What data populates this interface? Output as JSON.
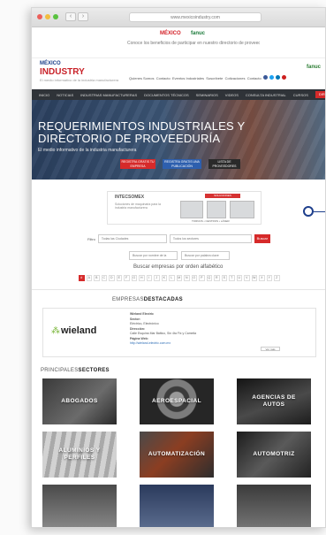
{
  "browser": {
    "url": "www.mexicoindustry.com",
    "back": "‹",
    "forward": "›"
  },
  "promo": {
    "brand_a": "MÉXICO",
    "brand_b": "fanuc",
    "text": "Conoce los beneficios de participar en nuestro directorio de proveedores"
  },
  "header": {
    "logo_top": "MÉXICO",
    "logo_main": "INDUSTRY",
    "tagline": "El medio informativo de la industria manufacturera",
    "links": [
      "Quienes Somos",
      "Contacto",
      "Eventos Industriales",
      "Suscríbete",
      "Cotizaciones",
      "Contacto"
    ],
    "sponsor": "fanuc"
  },
  "nav": {
    "items": [
      "INICIO",
      "NOTICIAS",
      "INDUSTRIAS MANUFACTURERAS",
      "DOCUMENTOS TÉCNICOS",
      "SEMINARIOS",
      "VIDEOS",
      "CONSULTA INDUSTRIAL",
      "CURSOS"
    ],
    "cta": "DIRECTORIO"
  },
  "hero": {
    "title": "REQUERIMIENTOS INDUSTRIALES Y DIRECTORIO DE PROVEEDURÍA",
    "subtitle": "El medio informativo de la industria manufacturera",
    "buttons": [
      "REGISTRA GRATIS TU EMPRESA",
      "REGISTRA GRATIS UNA PUBLICACIÓN",
      "LISTA DE PROVEEDORES"
    ]
  },
  "ad": {
    "title": "INTECSOMEX",
    "subtitle": "Soluciones de maquinaria para la industria manufacturera",
    "badge": "SOLUCIONES INDUSTRIALES",
    "labels": "TORNOS  •  CENTROS  •  LÁSER"
  },
  "search": {
    "label": "Filtro",
    "field1": "Todas las Ciudades",
    "field2": "Todos los sectores",
    "button": "Buscar",
    "field3": "Buscar por nombre de la",
    "field4": "Buscar por palabra clave"
  },
  "alphabet": {
    "label": "Buscar empresas por orden alfabético",
    "letters": [
      "#",
      "A",
      "B",
      "C",
      "D",
      "E",
      "F",
      "G",
      "H",
      "I",
      "J",
      "K",
      "L",
      "M",
      "N",
      "O",
      "P",
      "Q",
      "R",
      "S",
      "T",
      "U",
      "V",
      "W",
      "X",
      "Y",
      "Z"
    ]
  },
  "featured": {
    "title_light": "EMPRESAS",
    "title_bold": "DESTACADAS",
    "company": "wieland",
    "info_name": "Wieland Electric",
    "info_sector": "Sector:",
    "info_sector_val": "Eléctrico, Electrónico",
    "info_address": "Dirección:",
    "info_address_val": "Calle Esquina Mar Báltico, Sin 4ta Fix y Camelia",
    "info_web": "Página Web:",
    "info_web_val": "http://wieland-electric.com.mx",
    "more_button": "Ver más"
  },
  "sectors": {
    "title_light": "PRINCIPALES",
    "title_bold": "SECTORES",
    "tiles": [
      "ABOGADOS",
      "AEROESPACIAL",
      "AGENCIAS DE AUTOS",
      "ALUMINIOS Y PERFILES",
      "AUTOMATIZACIÓN",
      "AUTOMOTRIZ",
      "",
      "",
      ""
    ]
  },
  "colors": {
    "accent": "#d62a2a",
    "brand_blue": "#1e3f8c",
    "nav_bg": "#2f3338"
  }
}
